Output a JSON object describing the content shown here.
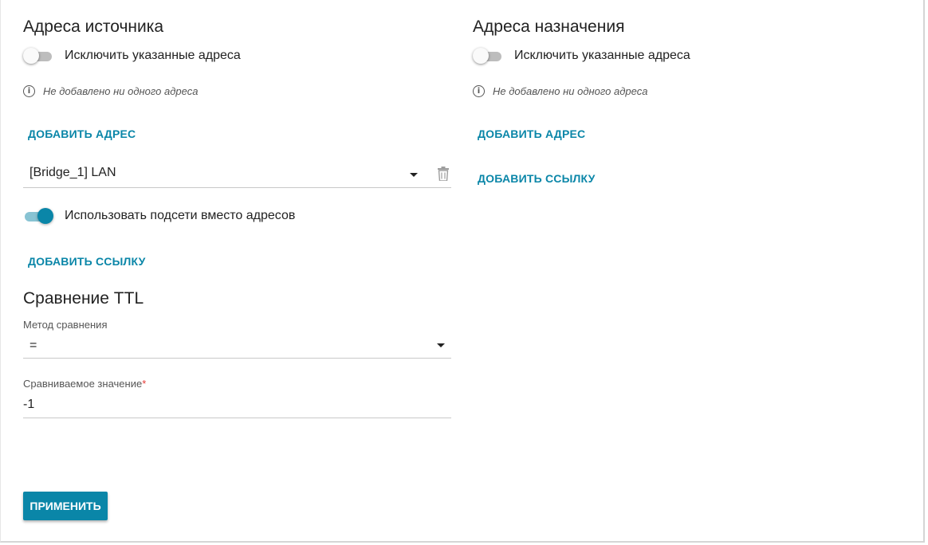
{
  "source": {
    "title": "Адреса источника",
    "exclude_label": "Исключить указанные адреса",
    "exclude_enabled": false,
    "empty_note": "Не добавлено ни одного адреса",
    "add_address_label": "ДОБАВИТЬ АДРЕС",
    "selected_interface": "[Bridge_1] LAN",
    "use_subnets_label": "Использовать подсети вместо адресов",
    "use_subnets_enabled": true,
    "add_link_label": "ДОБАВИТЬ ССЫЛКУ"
  },
  "destination": {
    "title": "Адреса назначения",
    "exclude_label": "Исключить указанные адреса",
    "exclude_enabled": false,
    "empty_note": "Не добавлено ни одного адреса",
    "add_address_label": "ДОБАВИТЬ АДРЕС",
    "add_link_label": "ДОБАВИТЬ ССЫЛКУ"
  },
  "ttl": {
    "title": "Сравнение TTL",
    "method_label": "Метод сравнения",
    "method_value": "=",
    "value_label": "Сравниваемое значение",
    "required_mark": "*",
    "value": "-1"
  },
  "actions": {
    "apply_label": "ПРИМЕНИТЬ"
  },
  "colors": {
    "accent": "#0a86a8",
    "required": "#e53935"
  }
}
